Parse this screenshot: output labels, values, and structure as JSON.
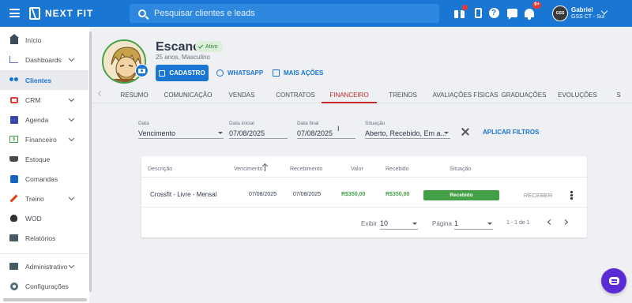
{
  "topbar": {
    "brand": "NEXT FIT",
    "search_placeholder": "Pesquisar clientes e leads",
    "notification_count": "9+",
    "user_name": "Gabriel",
    "user_unit": "GSS CT - Sul",
    "user_avatar_text": "GSS",
    "icons": [
      "menu-icon",
      "gift-icon",
      "phone-icon",
      "help-icon",
      "chat-icon",
      "bell-icon"
    ],
    "color": "#1976d2"
  },
  "sidebar": {
    "items": [
      {
        "label": "Início",
        "icon": "home-icon",
        "chevron": false,
        "active": false
      },
      {
        "label": "Dashboards",
        "icon": "chart-icon",
        "chevron": true,
        "active": false
      },
      {
        "label": "Clientes",
        "icon": "people-icon",
        "chevron": false,
        "active": true
      },
      {
        "label": "CRM",
        "icon": "crm-icon",
        "chevron": true,
        "active": false
      },
      {
        "label": "Agenda",
        "icon": "calendar-icon",
        "chevron": true,
        "active": false
      },
      {
        "label": "Financeiro",
        "icon": "money-icon",
        "chevron": true,
        "active": false
      },
      {
        "label": "Estoque",
        "icon": "cart-icon",
        "chevron": false,
        "active": false
      },
      {
        "label": "Comandas",
        "icon": "bag-icon",
        "chevron": false,
        "active": false
      },
      {
        "label": "Treino",
        "icon": "dumbbell-icon",
        "chevron": true,
        "active": false
      },
      {
        "label": "WOD",
        "icon": "kettlebell-icon",
        "chevron": false,
        "active": false
      },
      {
        "label": "Relatórios",
        "icon": "report-icon",
        "chevron": false,
        "active": false
      },
      {
        "label": "Administrativo",
        "icon": "admin-icon",
        "chevron": true,
        "active": false
      },
      {
        "label": "Configurações",
        "icon": "gear-icon",
        "chevron": false,
        "active": false
      }
    ]
  },
  "profile": {
    "name": "Escanor",
    "status": "Ativo",
    "subtitle": "25 anos, Masculino",
    "actions": {
      "cadastro": "CADASTRO",
      "whatsapp": "WHATSAPP",
      "more": "MAIS AÇÕES"
    },
    "status_color": "#43a047"
  },
  "tabs": [
    "RESUMO",
    "COMUNICAÇÃO",
    "VENDAS",
    "CONTRATOS",
    "FINANCEIRO",
    "TREINOS",
    "AVALIAÇÕES FÍSICAS",
    "GRADUAÇÕES",
    "EVOLUÇÕES",
    "S"
  ],
  "active_tab": "FINANCEIRO",
  "filters": {
    "data": {
      "label": "Data",
      "value": "Vencimento"
    },
    "data_inicial": {
      "label": "Data inicial",
      "value": "07/08/2025"
    },
    "data_final": {
      "label": "Data final",
      "value": "07/08/2025"
    },
    "situacao": {
      "label": "Situação",
      "value": "Aberto, Recebido, Em a..."
    },
    "apply": "APLICAR FILTROS"
  },
  "table": {
    "headers": [
      "Descrição",
      "Vencimento",
      "Recebimento",
      "Valor",
      "Recebido",
      "Situação"
    ],
    "rows": [
      {
        "descricao": "Crossfit - Livre - Mensal",
        "vencimento": "07/08/2025",
        "recebimento": "07/08/2025",
        "valor": "R$350,00",
        "recebido": "R$350,00",
        "situacao": "Recebido",
        "action": "RECEBER"
      }
    ]
  },
  "pagination": {
    "exibir_label": "Exibir",
    "exibir_value": "10",
    "pagina_label": "Página",
    "pagina_value": "1",
    "range": "1 - 1 de 1"
  }
}
